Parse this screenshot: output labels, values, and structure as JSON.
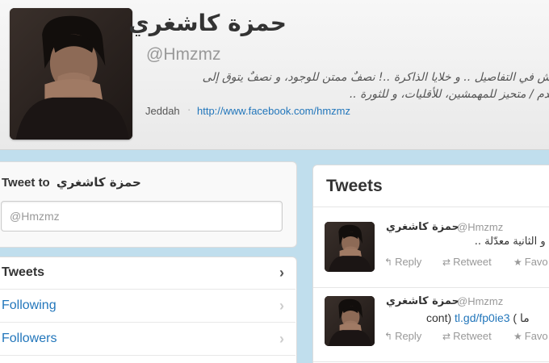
{
  "profile": {
    "name": "حمزة كاشغري",
    "handle": "@Hmzmz",
    "bio_line1": "..يش في التفاصيل .. و خلايا الذاكرة ..! نصفٌ ممتن للوجود، و نصفٌ يتوق إلى",
    "bio_line2": "العدم / متحيز للمهمشين، للأقليات، و للثورة ..",
    "location": "Jeddah",
    "separator": "·",
    "url": "http://www.facebook.com/hmzmz"
  },
  "tweet_to": {
    "label": "Tweet to",
    "name": "حمزة كاشغري",
    "input_value": "@Hmzmz"
  },
  "nav": {
    "items": [
      {
        "label": "Tweets",
        "chevron": "›"
      },
      {
        "label": "Following",
        "chevron": "›"
      },
      {
        "label": "Followers",
        "chevron": "›"
      }
    ]
  },
  "tweets_panel": {
    "title": "Tweets",
    "tweets": [
      {
        "name": "حمزة كاشغري",
        "handle": "@Hmzmz",
        "text": "، و الثانية معدّلة ..",
        "reply": "Reply",
        "retweet": "Retweet",
        "favorite": "Favo"
      },
      {
        "name": "حمزة كاشغري",
        "handle": "@Hmzmz",
        "text_prefix": "cont) ",
        "link": "tl.gd/fp0ie3",
        "text_suffix": " ( ما",
        "reply": "Reply",
        "retweet": "Retweet",
        "favorite": "Favo"
      }
    ]
  },
  "icons": {
    "reply": "reply-icon",
    "retweet": "retweet-icon",
    "favorite": "star-icon",
    "chevron": "chevron-right-icon"
  },
  "colors": {
    "link": "#2276bb",
    "background": "#c0deed",
    "text": "#333333",
    "muted": "#999999"
  }
}
